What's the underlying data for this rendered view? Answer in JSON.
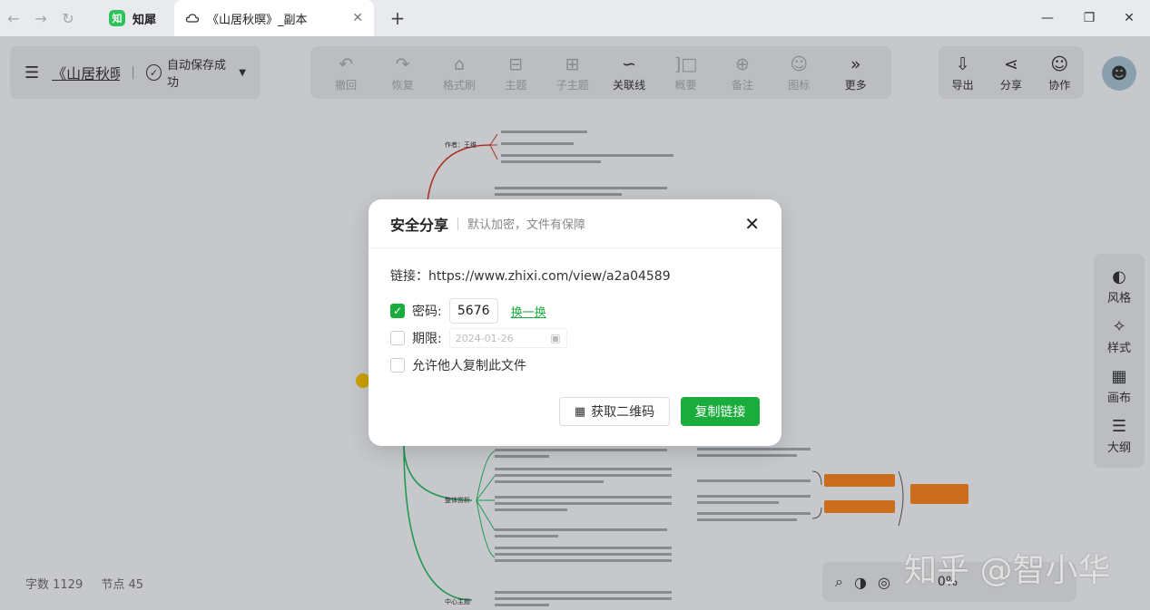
{
  "browser": {
    "tabs": [
      {
        "label": "知犀",
        "logo": "知"
      },
      {
        "label": "《山居秋暝》_副本"
      }
    ],
    "new_tab": "+",
    "nav": {
      "back": "←",
      "forward": "→",
      "reload": "↻"
    },
    "window": {
      "minimize": "—",
      "restore": "❐",
      "close": "✕"
    },
    "tab_close": "✕"
  },
  "doc": {
    "title": "《山居秋暝》_副本",
    "save_status": "自动保存成功"
  },
  "toolbar": [
    {
      "label": "撤回",
      "icon": "↶",
      "enabled": false
    },
    {
      "label": "恢复",
      "icon": "↷",
      "enabled": false
    },
    {
      "label": "格式刷",
      "icon": "⌂",
      "enabled": false
    },
    {
      "label": "主题",
      "icon": "⊟",
      "enabled": false
    },
    {
      "label": "子主题",
      "icon": "⊞",
      "enabled": false
    },
    {
      "label": "关联线",
      "icon": "∽",
      "enabled": true
    },
    {
      "label": "概要",
      "icon": "]□",
      "enabled": false
    },
    {
      "label": "备注",
      "icon": "⊕",
      "enabled": false
    },
    {
      "label": "图标",
      "icon": "☺",
      "enabled": false
    },
    {
      "label": "更多",
      "icon": "»",
      "enabled": true
    }
  ],
  "right_actions": [
    {
      "label": "导出",
      "icon": "⇩"
    },
    {
      "label": "分享",
      "icon": "⋖"
    },
    {
      "label": "协作",
      "icon": "☺"
    }
  ],
  "side_panel": [
    {
      "label": "风格",
      "icon": "◐"
    },
    {
      "label": "样式",
      "icon": "✧"
    },
    {
      "label": "画布",
      "icon": "▦"
    },
    {
      "label": "大纲",
      "icon": "☰"
    }
  ],
  "stats": {
    "words": "字数 1129",
    "nodes": "节点 45"
  },
  "bottom_tools": {
    "zoom": "0%",
    "icons": [
      "⌕",
      "◑",
      "◎"
    ]
  },
  "watermark": "知乎 @智小华",
  "mindmap": {
    "nodes": [
      "作者：王维",
      "整体赏析",
      "中心主题"
    ]
  },
  "dialog": {
    "title": "安全分享",
    "subtitle": "默认加密，文件有保障",
    "link_label": "链接：",
    "link_url": "https://www.zhixi.com/view/a2a04589",
    "password_label": "密码:",
    "password_value": "5676",
    "password_checked": true,
    "refresh_label": "换一换",
    "expiry_label": "期限:",
    "expiry_placeholder": "2024-01-26",
    "expiry_checked": false,
    "allow_copy_label": "允许他人复制此文件",
    "allow_copy_checked": false,
    "qr_button": "获取二维码",
    "copy_button": "复制链接"
  },
  "colors": {
    "accent": "#1aad3d",
    "branch_red": "#c0392b",
    "branch_green": "#27ae60",
    "node_orange": "#e67e22"
  }
}
